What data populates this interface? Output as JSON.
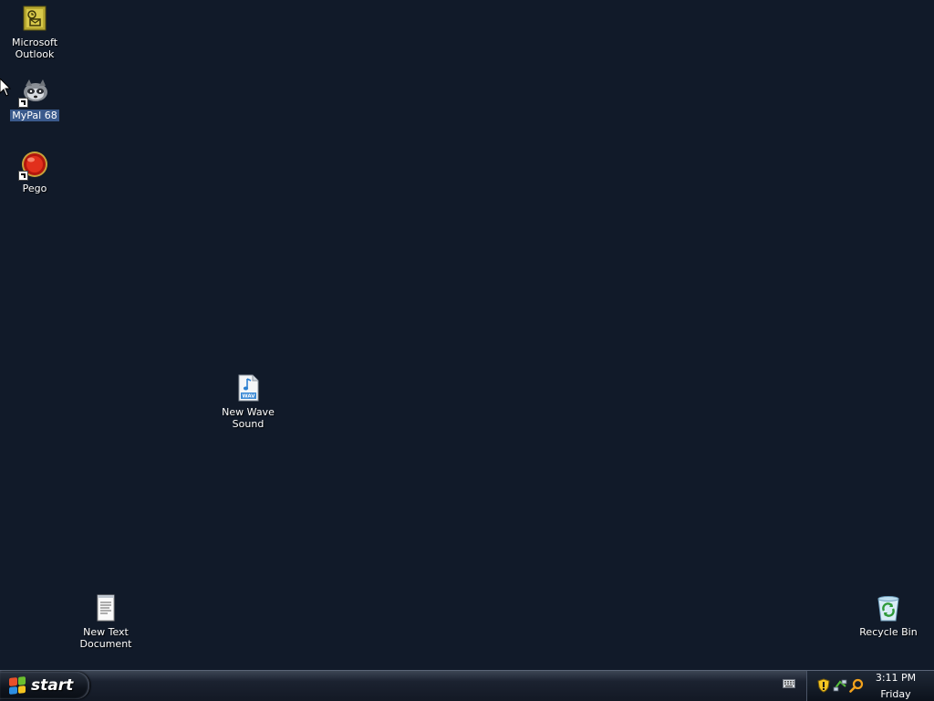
{
  "desktop": {
    "icons": [
      {
        "name": "Microsoft\nOutlook",
        "icon": "outlook-icon"
      },
      {
        "name": "MyPal 68",
        "icon": "mypal-icon",
        "selected": true,
        "shortcut": true
      },
      {
        "name": "Pego",
        "icon": "pego-icon",
        "shortcut": true
      },
      {
        "name": "New Wave\nSound",
        "icon": "wav-file-icon"
      },
      {
        "name": "New Text\nDocument",
        "icon": "text-document-icon"
      },
      {
        "name": "Recycle Bin",
        "icon": "recycle-bin-icon"
      }
    ]
  },
  "taskbar": {
    "start_label": "start",
    "clock": {
      "time": "3:11 PM",
      "day": "Friday"
    },
    "tray_icons": [
      "keyboard-icon",
      "security-shield-icon",
      "network-icon",
      "search-icon"
    ]
  },
  "colors": {
    "desktop_bg": "#111a29",
    "taskbar": "#131925",
    "selection": "#3a5a8c"
  }
}
